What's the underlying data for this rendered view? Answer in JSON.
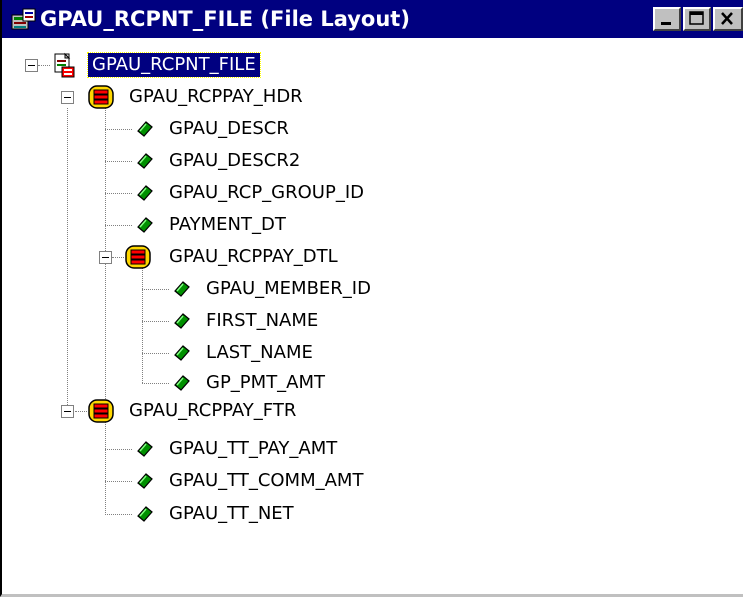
{
  "window": {
    "title": "GPAU_RCPNT_FILE (File Layout)",
    "controls": [
      "minimize",
      "maximize",
      "close"
    ]
  },
  "tree": {
    "root": "GPAU_RCPNT_FILE",
    "records": {
      "hdr": {
        "label": "GPAU_RCPPAY_HDR",
        "fields": [
          "GPAU_DESCR",
          "GPAU_DESCR2",
          "GPAU_RCP_GROUP_ID",
          "PAYMENT_DT"
        ],
        "child": {
          "label": "GPAU_RCPPAY_DTL",
          "fields": [
            "GPAU_MEMBER_ID",
            "FIRST_NAME",
            "LAST_NAME",
            "GP_PMT_AMT"
          ]
        }
      },
      "ftr": {
        "label": "GPAU_RCPPAY_FTR",
        "fields": [
          "GPAU_TT_PAY_AMT",
          "GPAU_TT_COMM_AMT",
          "GPAU_TT_NET"
        ]
      }
    }
  },
  "colors": {
    "titlebar": "#000080",
    "selection": "#000080",
    "record_icon": "#ffd700",
    "field_icon": "#009000"
  },
  "icons": {
    "app": "file-layout-icon",
    "file": "file-definition-icon",
    "record": "record-icon",
    "field": "field-icon"
  }
}
